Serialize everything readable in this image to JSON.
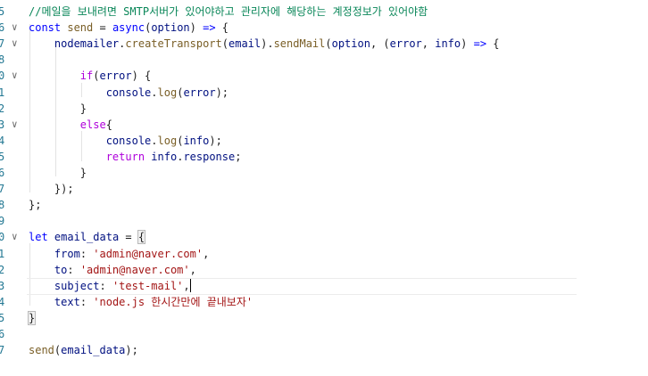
{
  "editor": {
    "cursor_line": "8",
    "lines": [
      {
        "num": "5",
        "fold": "",
        "tokens": [
          {
            "t": "//메일을 보내려면 SMTP서버가 있어야하고 관리자에 해당하는 계정정보가 있어야함",
            "c": "comment"
          }
        ]
      },
      {
        "num": "6",
        "fold": "∨",
        "tokens": [
          {
            "t": "const",
            "c": "keyword"
          },
          {
            "t": " ",
            "c": "plain"
          },
          {
            "t": "send",
            "c": "func"
          },
          {
            "t": " = ",
            "c": "plain"
          },
          {
            "t": "async",
            "c": "keyword"
          },
          {
            "t": "(",
            "c": "plain"
          },
          {
            "t": "option",
            "c": "var"
          },
          {
            "t": ") ",
            "c": "plain"
          },
          {
            "t": "=>",
            "c": "keyword"
          },
          {
            "t": " {",
            "c": "brace"
          }
        ]
      },
      {
        "num": "7",
        "fold": "∨",
        "tokens": [
          {
            "t": "    ",
            "c": "plain"
          },
          {
            "t": "nodemailer",
            "c": "var"
          },
          {
            "t": ".",
            "c": "plain"
          },
          {
            "t": "createTransport",
            "c": "func"
          },
          {
            "t": "(",
            "c": "plain"
          },
          {
            "t": "email",
            "c": "var"
          },
          {
            "t": ").",
            "c": "plain"
          },
          {
            "t": "sendMail",
            "c": "func"
          },
          {
            "t": "(",
            "c": "plain"
          },
          {
            "t": "option",
            "c": "var"
          },
          {
            "t": ", (",
            "c": "plain"
          },
          {
            "t": "error",
            "c": "var"
          },
          {
            "t": ", ",
            "c": "plain"
          },
          {
            "t": "info",
            "c": "var"
          },
          {
            "t": ") ",
            "c": "plain"
          },
          {
            "t": "=>",
            "c": "keyword"
          },
          {
            "t": " {",
            "c": "brace"
          }
        ]
      },
      {
        "num": "8",
        "fold": "",
        "tokens": [
          {
            "t": "",
            "c": "plain"
          }
        ]
      },
      {
        "num": "0",
        "fold": "∨",
        "tokens": [
          {
            "t": "        ",
            "c": "plain"
          },
          {
            "t": "if",
            "c": "control"
          },
          {
            "t": "(",
            "c": "plain"
          },
          {
            "t": "error",
            "c": "var"
          },
          {
            "t": ") {",
            "c": "brace"
          }
        ]
      },
      {
        "num": "1",
        "fold": "",
        "tokens": [
          {
            "t": "            ",
            "c": "plain"
          },
          {
            "t": "console",
            "c": "var"
          },
          {
            "t": ".",
            "c": "plain"
          },
          {
            "t": "log",
            "c": "func"
          },
          {
            "t": "(",
            "c": "plain"
          },
          {
            "t": "error",
            "c": "var"
          },
          {
            "t": ");",
            "c": "plain"
          }
        ]
      },
      {
        "num": "2",
        "fold": "",
        "tokens": [
          {
            "t": "        }",
            "c": "brace"
          }
        ]
      },
      {
        "num": "3",
        "fold": "∨",
        "tokens": [
          {
            "t": "        ",
            "c": "plain"
          },
          {
            "t": "else",
            "c": "control"
          },
          {
            "t": "{",
            "c": "brace"
          }
        ]
      },
      {
        "num": "4",
        "fold": "",
        "tokens": [
          {
            "t": "            ",
            "c": "plain"
          },
          {
            "t": "console",
            "c": "var"
          },
          {
            "t": ".",
            "c": "plain"
          },
          {
            "t": "log",
            "c": "func"
          },
          {
            "t": "(",
            "c": "plain"
          },
          {
            "t": "info",
            "c": "var"
          },
          {
            "t": ");",
            "c": "plain"
          }
        ]
      },
      {
        "num": "5",
        "fold": "",
        "tokens": [
          {
            "t": "            ",
            "c": "plain"
          },
          {
            "t": "return",
            "c": "control"
          },
          {
            "t": " ",
            "c": "plain"
          },
          {
            "t": "info",
            "c": "var"
          },
          {
            "t": ".",
            "c": "plain"
          },
          {
            "t": "response",
            "c": "var"
          },
          {
            "t": ";",
            "c": "plain"
          }
        ]
      },
      {
        "num": "6",
        "fold": "",
        "tokens": [
          {
            "t": "        }",
            "c": "brace"
          }
        ]
      },
      {
        "num": "7",
        "fold": "",
        "tokens": [
          {
            "t": "    });",
            "c": "brace"
          }
        ]
      },
      {
        "num": "8",
        "fold": "",
        "tokens": [
          {
            "t": "};",
            "c": "brace"
          }
        ]
      },
      {
        "num": "9",
        "fold": "",
        "tokens": [
          {
            "t": "",
            "c": "plain"
          }
        ]
      },
      {
        "num": "0",
        "fold": "∨",
        "tokens": [
          {
            "t": "let",
            "c": "keyword"
          },
          {
            "t": " ",
            "c": "plain"
          },
          {
            "t": "email_data",
            "c": "var"
          },
          {
            "t": " = ",
            "c": "plain"
          },
          {
            "t": "{",
            "c": "brace",
            "match": true
          }
        ]
      },
      {
        "num": "1",
        "fold": "",
        "tokens": [
          {
            "t": "    ",
            "c": "plain"
          },
          {
            "t": "from",
            "c": "var"
          },
          {
            "t": ": ",
            "c": "plain"
          },
          {
            "t": "'admin@naver.com'",
            "c": "string"
          },
          {
            "t": ",",
            "c": "plain"
          }
        ]
      },
      {
        "num": "2",
        "fold": "",
        "tokens": [
          {
            "t": "    ",
            "c": "plain"
          },
          {
            "t": "to",
            "c": "var"
          },
          {
            "t": ": ",
            "c": "plain"
          },
          {
            "t": "'admin@naver.com'",
            "c": "string"
          },
          {
            "t": ",",
            "c": "plain"
          }
        ]
      },
      {
        "num": "3",
        "fold": "",
        "current": true,
        "tokens": [
          {
            "t": "    ",
            "c": "plain"
          },
          {
            "t": "subject",
            "c": "var"
          },
          {
            "t": ": ",
            "c": "plain"
          },
          {
            "t": "'test-mail'",
            "c": "string"
          },
          {
            "t": ",",
            "c": "plain"
          }
        ]
      },
      {
        "num": "4",
        "fold": "",
        "tokens": [
          {
            "t": "    ",
            "c": "plain"
          },
          {
            "t": "text",
            "c": "var"
          },
          {
            "t": ": ",
            "c": "plain"
          },
          {
            "t": "'node.js 한시간만에 끝내보자'",
            "c": "string"
          }
        ]
      },
      {
        "num": "5",
        "fold": "",
        "tokens": [
          {
            "t": "}",
            "c": "brace",
            "match": true
          }
        ]
      },
      {
        "num": "6",
        "fold": "",
        "tokens": [
          {
            "t": "",
            "c": "plain"
          }
        ]
      },
      {
        "num": "7",
        "fold": "",
        "tokens": [
          {
            "t": "send",
            "c": "func"
          },
          {
            "t": "(",
            "c": "plain"
          },
          {
            "t": "email_data",
            "c": "var"
          },
          {
            "t": ");",
            "c": "plain"
          }
        ]
      }
    ]
  }
}
